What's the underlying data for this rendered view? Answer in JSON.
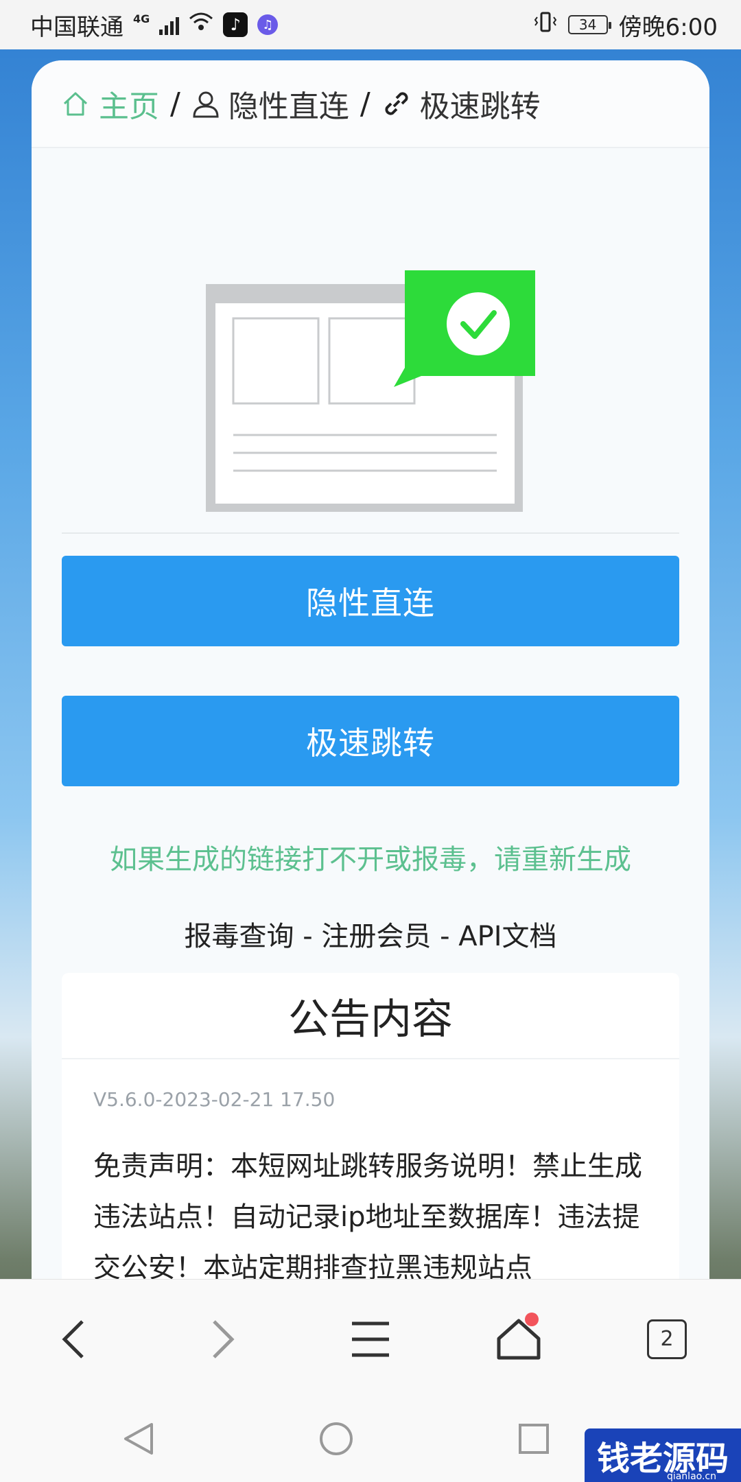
{
  "status_bar": {
    "carrier": "中国联通",
    "network": "4G",
    "battery": "34",
    "time": "傍晚6:00"
  },
  "breadcrumb": {
    "home": "主页",
    "sep1": "/",
    "item2": "隐性直连",
    "sep2": "/",
    "item3": "极速跳转"
  },
  "buttons": {
    "hidden_direct": "隐性直连",
    "fast_jump": "极速跳转"
  },
  "notice": "如果生成的链接打不开或报毒，请重新生成",
  "links": {
    "virus_check": "报毒查询",
    "sep1": " - ",
    "register": "注册会员",
    "sep2": " - ",
    "api_docs": "API文档"
  },
  "announcement": {
    "title": "公告内容",
    "version": "V5.6.0-2023-02-21 17.50",
    "body": "免责声明：本短网址跳转服务说明！禁止生成违法站点！自动记录ip地址至数据库！违法提交公安！本站定期排查拉黑违规站点"
  },
  "browser_toolbar": {
    "tab_count": "2"
  },
  "watermark": {
    "text": "钱老源码",
    "url": "qianlao.cn"
  },
  "colors": {
    "accent_blue": "#2a9af0",
    "success_green": "#5cc08f",
    "check_green": "#2ddb3a"
  }
}
